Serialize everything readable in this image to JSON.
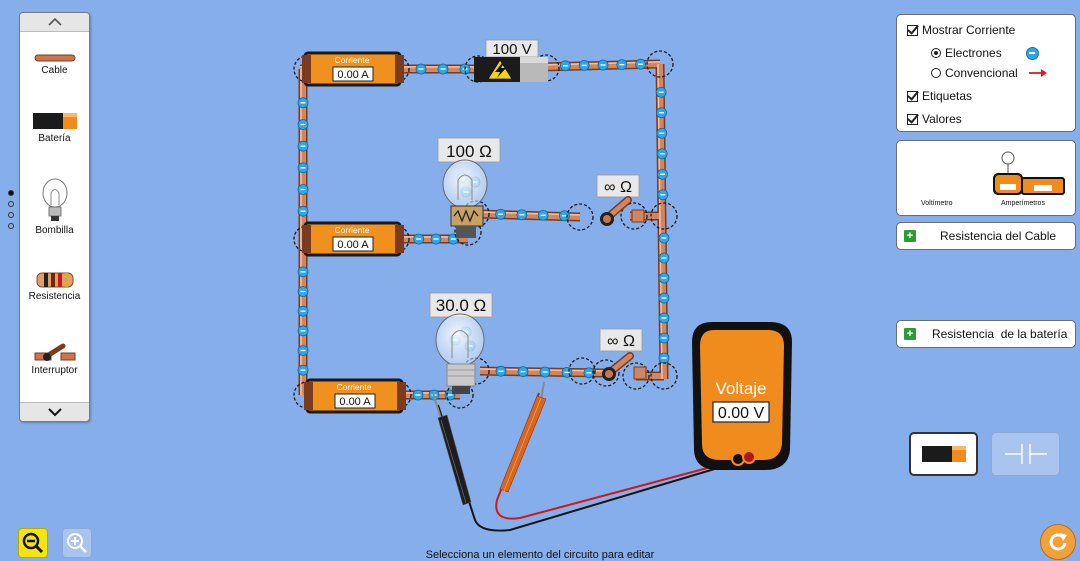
{
  "toolbox": {
    "items": [
      {
        "label": "Cable",
        "icon": "wire-icon"
      },
      {
        "label": "Batería",
        "icon": "battery-icon"
      },
      {
        "label": "Bombilla",
        "icon": "bulb-icon"
      },
      {
        "label": "Resistencia",
        "icon": "resistor-icon"
      },
      {
        "label": "Interruptor",
        "icon": "switch-icon"
      }
    ],
    "scroll_up_icon": "chevron-up-icon",
    "scroll_down_icon": "chevron-down-icon"
  },
  "circuit": {
    "battery_label": "100 V",
    "bulb1_label": "100 Ω",
    "bulb2_label": "30.0 Ω",
    "switch1_label": "∞ Ω",
    "switch2_label": "∞ Ω",
    "ammeter_title": "Corriente",
    "ammeter1_value": "0.00 A",
    "ammeter2_value": "0.00 A",
    "ammeter3_value": "0.00 A"
  },
  "voltmeter": {
    "title": "Voltaje",
    "value": "0.00 V"
  },
  "view_options": {
    "show_current_label": "Mostrar Corriente",
    "show_current_checked": true,
    "electrons_label": "Electrones",
    "electrons_selected": true,
    "conventional_label": "Convencional",
    "conventional_selected": false,
    "labels_label": "Etiquetas",
    "labels_checked": true,
    "values_label": "Valores",
    "values_checked": true
  },
  "instruments": {
    "voltmeter_label": "Voltímetro",
    "ammeters_label": "Amperímetros"
  },
  "wire_resistance_label": "Resistencia del Cable",
  "battery_resistance_label": "Resistencia  de la batería",
  "status_text": "Selecciona un elemento del circuito para editar",
  "colors": {
    "background": "#86aeeb",
    "wire": "#c9764f",
    "electron": "#2fa6e8",
    "meter_orange": "#f08c1e",
    "zoom_active": "#f5e50e"
  }
}
